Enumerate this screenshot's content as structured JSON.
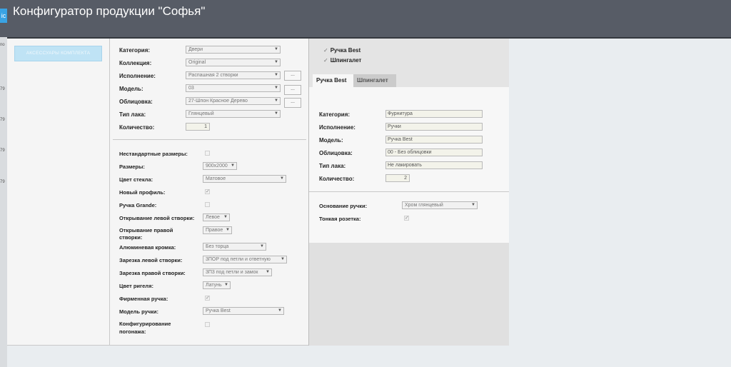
{
  "header": {
    "title": "Конфигуратор продукции \"Софья\"",
    "side_tab": "ic"
  },
  "left_strip": [
    "по",
    "79",
    "79",
    "79",
    "79"
  ],
  "left_panel": {
    "accessories_button": "АКСЕССУАРЫ КОМПЛЕКТА"
  },
  "main_form": {
    "category": {
      "label": "Категория:",
      "value": "Двери"
    },
    "collection": {
      "label": "Коллекция:",
      "value": "Original"
    },
    "execution": {
      "label": "Исполнение:",
      "value": "Распашная 2 створки"
    },
    "model": {
      "label": "Модель:",
      "value": "03"
    },
    "cladding": {
      "label": "Облицовка:",
      "value": "27-Шпон Красное Дерево"
    },
    "lacquer": {
      "label": "Тип лака:",
      "value": "Глянцевый"
    },
    "quantity": {
      "label": "Количество:",
      "value": "1"
    },
    "dots_button": "..."
  },
  "options": {
    "nonstandard": {
      "label": "Нестандартные размеры:",
      "checked": false
    },
    "sizes": {
      "label": "Размеры:",
      "value": "900x2000"
    },
    "glass_color": {
      "label": "Цвет стекла:",
      "value": "Матовое"
    },
    "new_profile": {
      "label": "Новый профиль:",
      "checked": true
    },
    "handle_grande": {
      "label": "Ручка Grande:",
      "checked": false
    },
    "left_opening": {
      "label": "Открывание левой створки:",
      "value": "Левое"
    },
    "right_opening": {
      "label_line1": "Открывание правой",
      "label_line2": "створки:",
      "value": "Правое"
    },
    "aluminium_edge": {
      "label": "Алюминевая кромка:",
      "value": "Без торца"
    },
    "left_cut": {
      "label": "Зарезка левой створки:",
      "value": "3ПОР под петли и ответную"
    },
    "right_cut": {
      "label": "Зарезка правой створки:",
      "value": "3П3 под петли и замок"
    },
    "bolt_color": {
      "label": "Цвет ригеля:",
      "value": "Латунь"
    },
    "brand_handle": {
      "label": "Фирменная ручка:",
      "checked": true
    },
    "handle_model": {
      "label": "Модель ручки:",
      "value": "Ручка Best"
    },
    "molding_config": {
      "label_line1": "Конфигурирование",
      "label_line2": "погонажа:",
      "checked": false
    }
  },
  "accessories": {
    "checked_items": [
      "Ручка Best",
      "Шпингалет"
    ],
    "tabs": [
      "Ручка Best",
      "Шпингалет"
    ],
    "active_tab": "Ручка Best",
    "detail": {
      "category": {
        "label": "Категория:",
        "value": "Фурнитура"
      },
      "execution": {
        "label": "Исполнение:",
        "value": "Ручки"
      },
      "model": {
        "label": "Модель:",
        "value": "Ручка Best"
      },
      "cladding": {
        "label": "Облицовка:",
        "value": "00 - Без облицовки"
      },
      "lacquer": {
        "label": "Тип лака:",
        "value": "Не лакировать"
      },
      "quantity": {
        "label": "Количество:",
        "value": "2"
      }
    },
    "handle_base": {
      "label": "Основание ручки:",
      "value": "Хром глянцевый"
    },
    "thin_rosette": {
      "label": "Тонкая розетка:",
      "checked": true
    }
  },
  "colors": {
    "header_bg": "#575c66",
    "accent": "#3aa3e3",
    "accessory_button_bg": "#bfe3f5"
  }
}
